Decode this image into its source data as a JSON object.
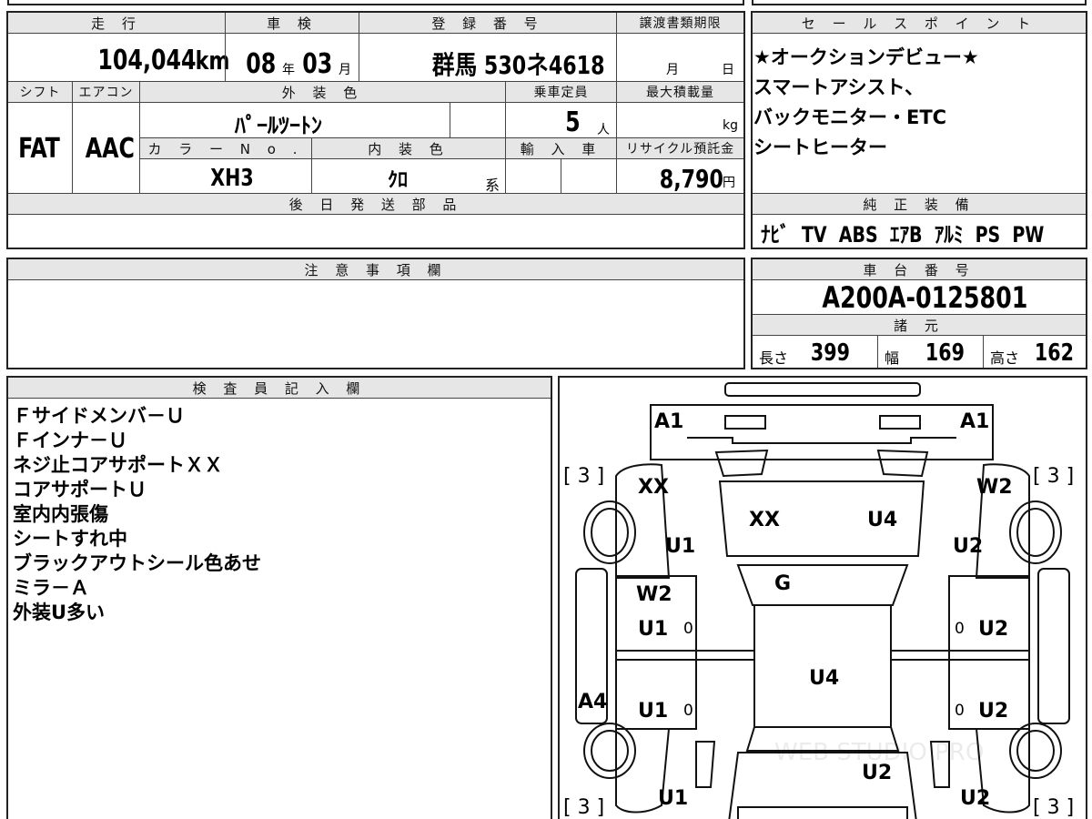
{
  "top_fragment": "",
  "vehicle": {
    "headers": {
      "mileage": "走 行",
      "inspection": "車 検",
      "registration": "登 録 番 号",
      "transfer_deadline": "譲渡書類期限",
      "shift": "シフト",
      "aircon": "エアコン",
      "exterior_color": "外 装 色",
      "capacity": "乗車定員",
      "max_load": "最大積載量",
      "color_no": "カ ラ ー N o .",
      "interior_color": "内 装 色",
      "import": "輸 入 車",
      "recycle": "リサイクル預託金"
    },
    "mileage": "104,044",
    "mileage_unit": "km",
    "inspection_year": "08",
    "inspection_year_unit": "年",
    "inspection_month": "03",
    "inspection_month_unit": "月",
    "registration_number": "群馬 530ネ4618",
    "deadline_month_unit": "月",
    "deadline_day_unit": "日",
    "shift": "FAT",
    "aircon": "AAC",
    "exterior_color": "ﾊﾟｰﾙﾂｰﾄﾝ",
    "capacity": "5",
    "capacity_unit": "人",
    "max_load_unit": "kg",
    "color_no": "XH3",
    "interior_color": "ｸﾛ",
    "interior_suffix": "系",
    "recycle_fee": "8,790",
    "recycle_unit": "円",
    "later_parts_header": "後 日 発 送 部 品",
    "notes_header": "注 意 事 項 欄"
  },
  "sales_points": {
    "header": "セ ー ル ス ポ イ ン ト",
    "lines": [
      "★オークションデビュー★",
      "スマートアシスト、",
      "バックモニター・ETC",
      "シートヒーター"
    ]
  },
  "equipment": {
    "header": "純 正 装 備",
    "items": "ﾅﾋﾞ  TV  ABS  ｴｱB  ｱﾙﾐ  PS  PW"
  },
  "chassis": {
    "header": "車 台 番 号",
    "number": "A200A-0125801",
    "specs_header": "諸 元",
    "length_label": "長さ",
    "length": "399",
    "width_label": "幅",
    "width": "169",
    "height_label": "高さ",
    "height": "162"
  },
  "inspector": {
    "header": "検 査 員 記 入 欄",
    "lines": [
      "Ｆサイドメンバ－Ｕ",
      "Ｆインナ－Ｕ",
      "ネジ止コアサポートＸＸ",
      "コアサポートＵ",
      "室内内張傷",
      "シートすれ中",
      "ブラックアウトシール色あせ",
      "ミラ－Ａ",
      "外装U多い"
    ]
  },
  "diagram": {
    "labels": {
      "a1_left": "A1",
      "a1_right": "A1",
      "bracket_tl": "[ 3 ]",
      "bracket_tr": "[ 3 ]",
      "bracket_bl": "[ 3 ]",
      "bracket_br": "[ 3 ]",
      "xx_left": "XX",
      "w2_right": "W2",
      "xx_hood": "XX",
      "u4_hood": "U4",
      "u1_fl": "U1",
      "u2_fr": "U2",
      "g": "G",
      "w2_door": "W2",
      "u1_door1": "U1",
      "u2_door1": "U2",
      "u4_roof": "U4",
      "a4": "A4",
      "u1_door2": "U1",
      "u2_door2": "U2",
      "u2_rear": "U2",
      "u1_rl": "U1",
      "u2_rr": "U2",
      "zero1": "0",
      "zero2": "0",
      "zero3": "0",
      "zero4": "0"
    },
    "watermark": "WEB STUDIO PRO"
  }
}
